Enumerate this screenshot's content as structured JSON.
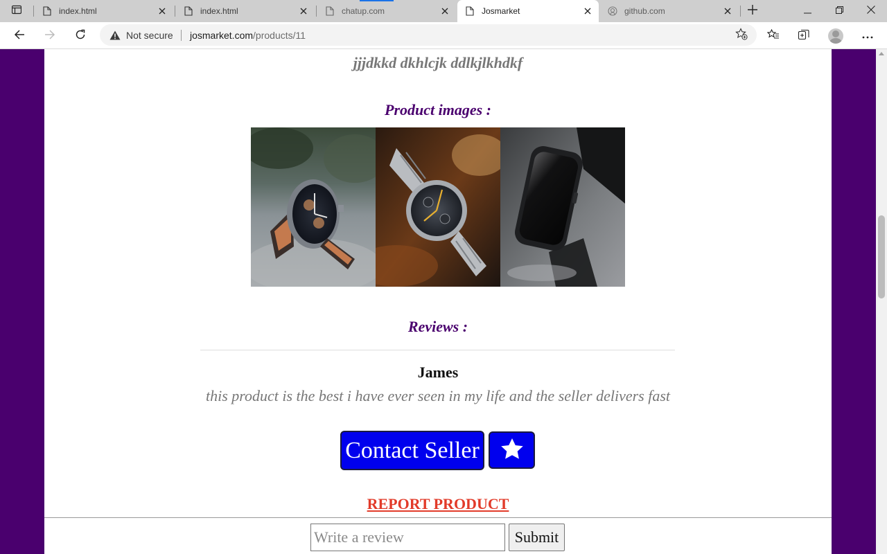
{
  "browser": {
    "tabs": [
      {
        "title": "index.html",
        "icon": "file-icon",
        "state": "inactive"
      },
      {
        "title": "index.html",
        "icon": "file-icon",
        "state": "inactive"
      },
      {
        "title": "chatup.com",
        "icon": "file-icon",
        "state": "dim"
      },
      {
        "title": "Josmarket",
        "icon": "file-icon",
        "state": "active"
      },
      {
        "title": "github.com",
        "icon": "github-icon",
        "state": "dim"
      }
    ],
    "security_label": "Not secure",
    "url_host": "josmarket.com",
    "url_path": "/products/11"
  },
  "product": {
    "description": "jjjdkkd dkhlcjk ddlkjlkhdkf",
    "images_title": "Product images :",
    "images": [
      {
        "name": "watch-photo-1",
        "description_icon": "chronograph-watch-on-gravel"
      },
      {
        "name": "watch-photo-2",
        "description_icon": "steel-watch-on-wood"
      },
      {
        "name": "watch-photo-3",
        "description_icon": "smartwatch"
      }
    ]
  },
  "reviews": {
    "title": "Reviews :",
    "items": [
      {
        "author": "James",
        "text": "this product is the best i have ever seen in my life and the seller delivers fast"
      }
    ]
  },
  "actions": {
    "contact_label": "Contact Seller",
    "favorite_icon": "star-icon",
    "report_label": "REPORT PRODUCT"
  },
  "review_form": {
    "placeholder": "Write a review",
    "submit_label": "Submit"
  },
  "colors": {
    "page_background": "#4a006e",
    "accent_button": "#0000ee",
    "report_link": "#e23b2a",
    "section_title": "#4a006e"
  }
}
